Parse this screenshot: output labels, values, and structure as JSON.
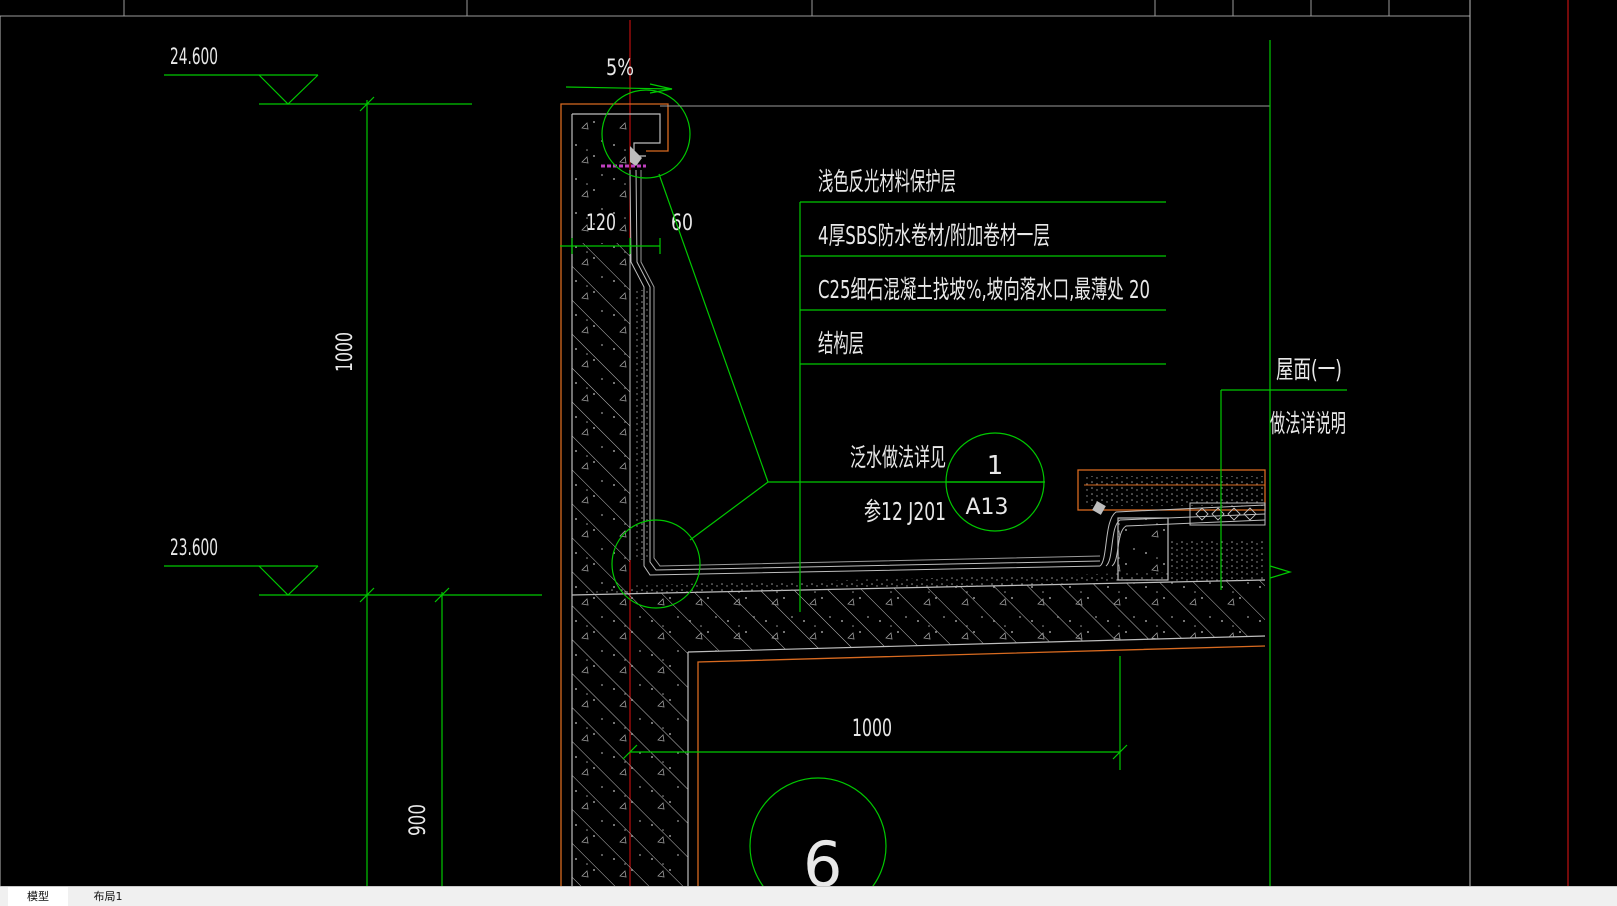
{
  "drawing": {
    "level_top": "24.600",
    "level_bottom": "23.600",
    "dim_vertical_1000": "1000",
    "dim_vertical_900": "900",
    "slope": "5%",
    "dim_120": "120",
    "dim_60": "60",
    "dim_bottom_1000": "1000",
    "layers": [
      {
        "label": "浅色反光材料保护层"
      },
      {
        "label": "4厚SBS防水卷材/附加卷材一层"
      },
      {
        "label": "C25细石混凝土找坡%,坡向落水口,最薄处 20"
      },
      {
        "label": "结构层"
      }
    ],
    "roof_note_1": "屋面(一)",
    "roof_note_2": "做法详说明",
    "flashing_note_1": "泛水做法详见",
    "flashing_note_2": "参12 J201",
    "detail_ref_number": "1",
    "detail_ref_sheet": "A13",
    "grid_label": "6"
  },
  "tabs": [
    {
      "label": "模型"
    },
    {
      "label": "布局1"
    }
  ],
  "colors": {
    "background": "#000000",
    "green": "#00c800",
    "red": "#e01010",
    "orange": "#d86a20",
    "white": "#e8e8e8",
    "gray": "#9a9a9a",
    "magenta": "#c040c0"
  }
}
